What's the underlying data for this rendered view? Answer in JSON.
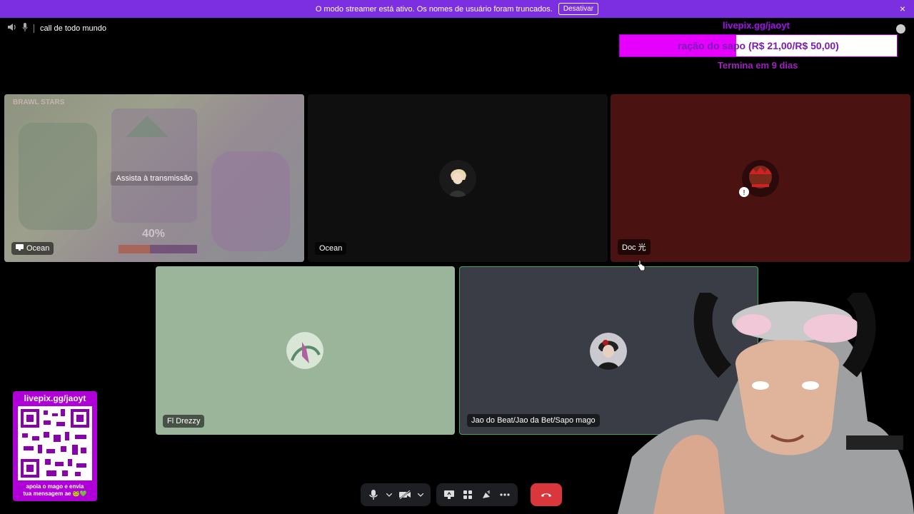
{
  "banner": {
    "message": "O modo streamer está ativo. Os nomes de usuário foram truncados.",
    "button_label": "Desativar",
    "close_icon": "×"
  },
  "channel": {
    "name": "call de todo mundo"
  },
  "goal": {
    "url": "livepix.gg/jaoyt",
    "label": "ração do sapo (R$ 21,00/R$ 50,00)",
    "progress": 0.42,
    "ends": "Termina em 9 dias"
  },
  "tiles": [
    {
      "name": "Ocean",
      "overlay": "Assista à transmissão",
      "game_logo": "BRAWL STARS",
      "game_progress_text": "40%",
      "game_progress": 0.4,
      "bg": "#6f7a5f"
    },
    {
      "name": "Ocean",
      "bg": "#0f0f10"
    },
    {
      "name": "Doc 光",
      "bg": "#4b1212"
    },
    {
      "name": "Fl Drezzy",
      "bg": "#9ab59a"
    },
    {
      "name": "Jao do Beat/Jao da Bet/Sapo mago",
      "bg": "#3b3d46",
      "speaking_color": "#3ba55d"
    }
  ],
  "qr": {
    "url": "livepix.gg/jaoyt",
    "caption_line1": "apoia o mago e envia",
    "caption_line2": "tua mensagem ae 🐸💚"
  },
  "controls": {
    "icons": [
      "microphone-icon",
      "chevron-down-icon",
      "camera-off-icon",
      "chevron-down-icon",
      "screen-share-icon",
      "activities-icon",
      "soundboard-icon",
      "more-icon",
      "leave-call-icon"
    ],
    "leave_color": "#da373c"
  },
  "colors": {
    "banner": "#7b2fe0",
    "accent_magenta": "#e500ff",
    "green_ring": "#3ba55d"
  }
}
